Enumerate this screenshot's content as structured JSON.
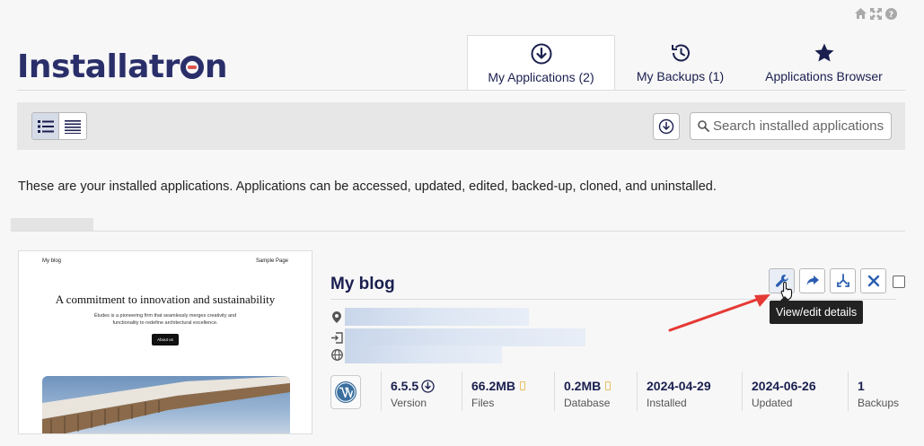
{
  "header": {
    "logo_prefix": "Install",
    "logo_middle": "atr",
    "logo_suffix": "n",
    "top_icons": [
      "home-icon",
      "fullscreen-icon",
      "help-icon"
    ]
  },
  "tabs": [
    {
      "label": "My Applications (2)",
      "icon": "download-circle-icon",
      "active": true
    },
    {
      "label": "My Backups (1)",
      "icon": "history-icon",
      "active": false
    },
    {
      "label": "Applications Browser",
      "icon": "star-icon",
      "active": false
    }
  ],
  "toolbar": {
    "search_placeholder": "Search installed applications"
  },
  "intro_text": "These are your installed applications. Applications can be accessed, updated, edited, backed-up, cloned, and uninstalled.",
  "app": {
    "title": "My blog",
    "thumbnail": {
      "site_name": "My blog",
      "nav_link": "Sample Page",
      "heading": "A commitment to innovation and sustainability",
      "subtext": "Études is a pioneering firm that seamlessly merges creativity and functionality to redefine architectural excellence.",
      "button": "About us"
    },
    "tooltip": "View/edit details",
    "stats": [
      {
        "value": "6.5.5",
        "label": "Version"
      },
      {
        "value": "66.2MB",
        "label": "Files"
      },
      {
        "value": "0.2MB",
        "label": "Database"
      },
      {
        "value": "2024-04-29",
        "label": "Installed"
      },
      {
        "value": "2024-06-26",
        "label": "Updated"
      },
      {
        "value": "1",
        "label": "Backups"
      }
    ]
  },
  "colors": {
    "brand": "#2a2f6a",
    "accent_red": "#d9534f",
    "action_blue": "#2a5db0",
    "arrow_red": "#e53935"
  }
}
